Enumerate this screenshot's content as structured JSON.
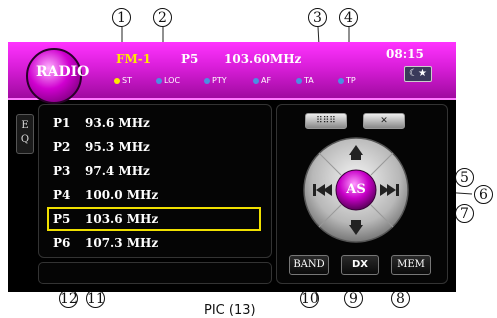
{
  "header": {
    "mode_label": "RADIO",
    "band": "FM-1",
    "preset": "P5",
    "frequency": "103.60MHz",
    "time": "08:15"
  },
  "status_indicators": [
    {
      "label": "ST",
      "color": "#ffea00"
    },
    {
      "label": "LOC",
      "color": "#4a90e2"
    },
    {
      "label": "PTY",
      "color": "#4a90e2"
    },
    {
      "label": "AF",
      "color": "#4a90e2"
    },
    {
      "label": "TA",
      "color": "#4a90e2"
    },
    {
      "label": "TP",
      "color": "#4a90e2"
    }
  ],
  "eq_tab": {
    "line1": "E",
    "line2": "Q"
  },
  "presets": [
    {
      "num": "P1",
      "freq": "93.6 MHz"
    },
    {
      "num": "P2",
      "freq": "95.3 MHz"
    },
    {
      "num": "P3",
      "freq": "97.4 MHz"
    },
    {
      "num": "P4",
      "freq": "100.0 MHz"
    },
    {
      "num": "P5",
      "freq": "103.6 MHz",
      "selected": true
    },
    {
      "num": "P6",
      "freq": "107.3 MHz"
    }
  ],
  "controls": {
    "center": "AS",
    "band_button": "BAND",
    "mem_button": "MEM",
    "dx_button": "DX"
  },
  "callouts": [
    "1",
    "2",
    "3",
    "4",
    "5",
    "6",
    "7",
    "8",
    "9",
    "10",
    "11",
    "12"
  ],
  "caption": "PIC (13)",
  "colors": {
    "accent_magenta": "#d91ed9",
    "selection_yellow": "#f0e000"
  }
}
